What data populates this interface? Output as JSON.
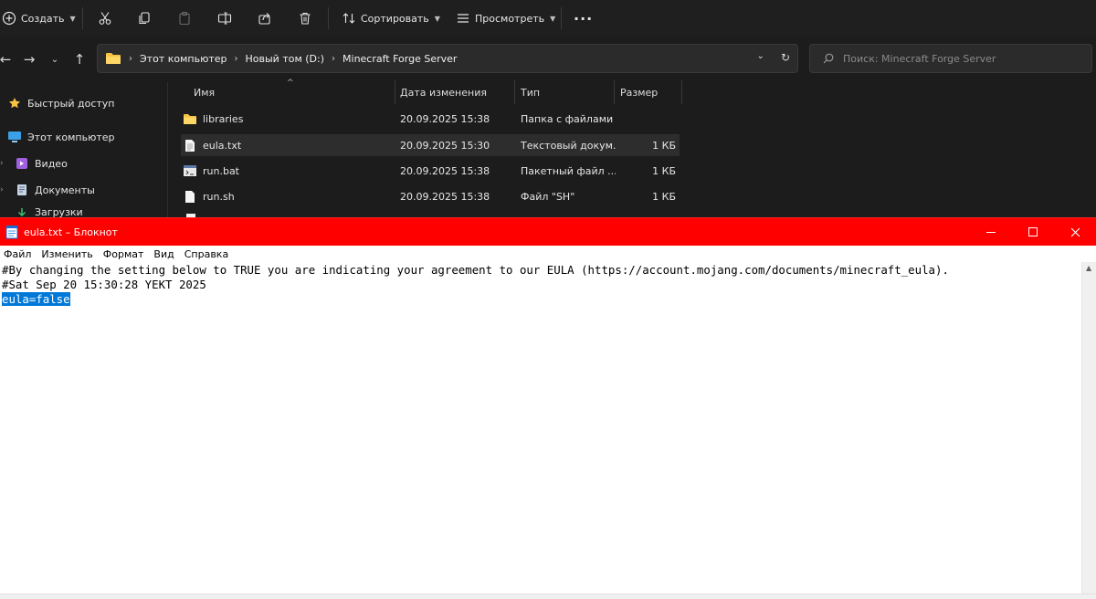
{
  "explorer": {
    "toolbar": {
      "create_label": "Создать",
      "sort_label": "Сортировать",
      "view_label": "Просмотреть",
      "more_label": "···"
    },
    "address": {
      "crumbs": [
        "Этот компьютер",
        "Новый том (D:)",
        "Minecraft Forge Server"
      ]
    },
    "search": {
      "placeholder": "Поиск: Minecraft Forge Server"
    },
    "sidebar": {
      "items": [
        {
          "label": "Быстрый доступ",
          "icon": "star-icon"
        },
        {
          "label": "Этот компьютер",
          "icon": "computer-icon"
        },
        {
          "label": "Видео",
          "icon": "video-folder-icon"
        },
        {
          "label": "Документы",
          "icon": "documents-folder-icon"
        },
        {
          "label": "Загрузки",
          "icon": "downloads-folder-icon"
        }
      ]
    },
    "columns": {
      "name": "Имя",
      "date": "Дата изменения",
      "type": "Тип",
      "size": "Размер"
    },
    "files": [
      {
        "name": "libraries",
        "date": "20.09.2025 15:38",
        "type": "Папка с файлами",
        "size": "",
        "icon": "folder-icon"
      },
      {
        "name": "eula.txt",
        "date": "20.09.2025 15:30",
        "type": "Текстовый докум...",
        "size": "1 КБ",
        "icon": "text-file-icon"
      },
      {
        "name": "run.bat",
        "date": "20.09.2025 15:38",
        "type": "Пакетный файл ...",
        "size": "1 КБ",
        "icon": "batch-file-icon"
      },
      {
        "name": "run.sh",
        "date": "20.09.2025 15:38",
        "type": "Файл \"SH\"",
        "size": "1 КБ",
        "icon": "file-icon"
      }
    ]
  },
  "notepad": {
    "title": "eula.txt – Блокнот",
    "menu": [
      "Файл",
      "Изменить",
      "Формат",
      "Вид",
      "Справка"
    ],
    "lines": [
      "#By changing the setting below to TRUE you are indicating your agreement to our EULA (https://account.mojang.com/documents/minecraft_eula).",
      "#Sat Sep 20 15:30:28 YEKT 2025",
      "eula=false"
    ],
    "selection_color": "#0078d7",
    "title_bar_color": "#ff0000"
  }
}
